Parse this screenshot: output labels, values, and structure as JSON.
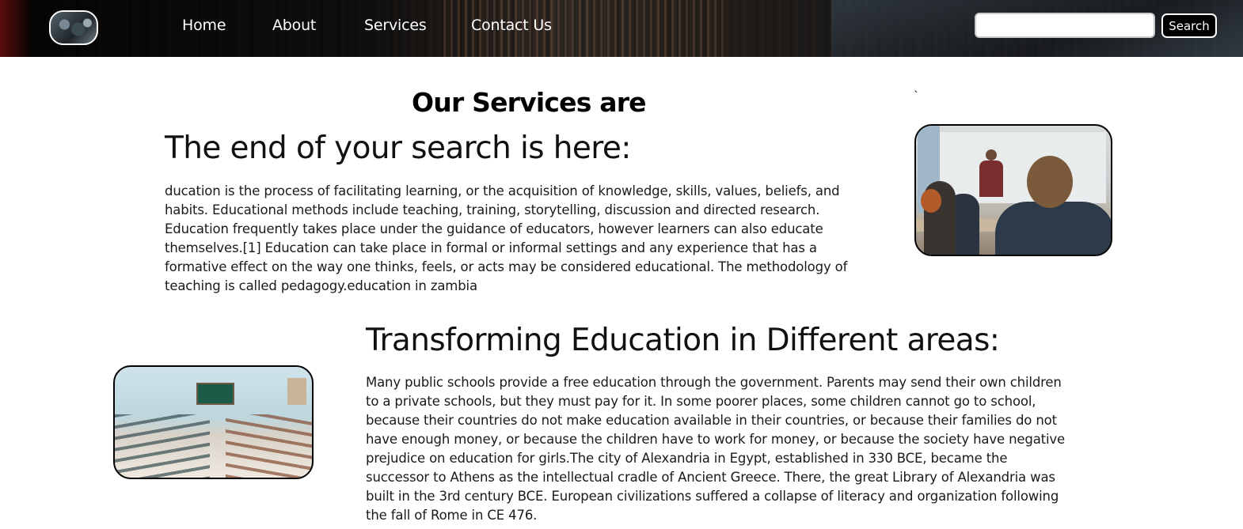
{
  "nav": {
    "logo_alt": "logo",
    "links": [
      "Home",
      "About",
      "Services",
      "Contact Us"
    ],
    "search": {
      "placeholder": "",
      "value": "",
      "button_label": "Search"
    }
  },
  "main": {
    "heading": "Our Services are",
    "stray_mark": "`",
    "section1": {
      "title": "The end of your search is here:",
      "body": "ducation is the process of facilitating learning, or the acquisition of knowledge, skills, values, beliefs, and habits. Educational methods include teaching, training, storytelling, discussion and directed research. Education frequently takes place under the guidance of educators, however learners can also educate themselves.[1] Education can take place in formal or informal settings and any experience that has a formative effect on the way one thinks, feels, or acts may be considered educational. The methodology of teaching is called pedagogy.education in zambia"
    },
    "section2": {
      "title": "Transforming Education in Different areas:",
      "body": "Many public schools provide a free education through the government. Parents may send their own children to a private schools, but they must pay for it. In some poorer places, some children cannot go to school, because their countries do not make education available in their countries, or because their families do not have enough money, or because the children have to work for money, or because the society have negative prejudice on education for girls.The city of Alexandria in Egypt, established in 330 BCE, became the successor to Athens as the intellectual cradle of Ancient Greece. There, the great Library of Alexandria was built in the 3rd century BCE. European civilizations suffered a collapse of literacy and organization following the fall of Rome in CE 476."
    }
  }
}
